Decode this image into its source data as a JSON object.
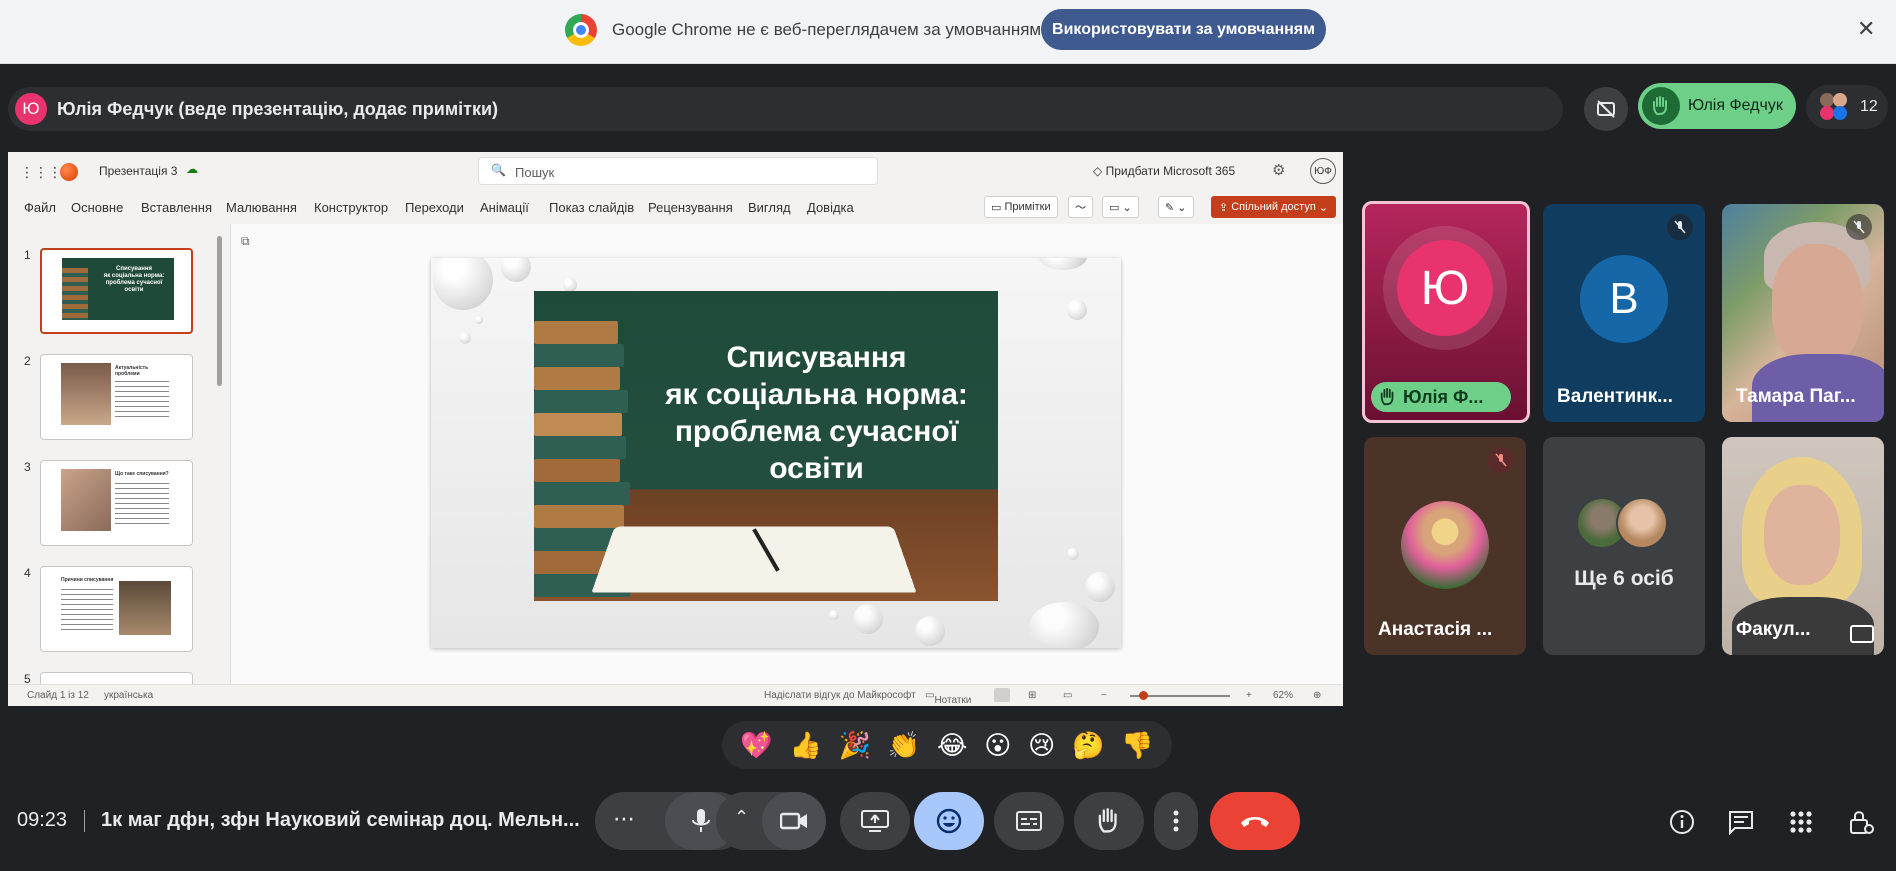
{
  "banner": {
    "message": "Google Chrome не є веб-переглядачем за умовчанням",
    "default_button": "Використовувати за умовчанням",
    "close_glyph": "✕"
  },
  "presenter": {
    "avatar_letter": "Ю",
    "text": "Юлія Федчук (веде презентацію, додає примітки)"
  },
  "top_right": {
    "hand_raised_name": "Юлія Федчук",
    "participants_count": "12"
  },
  "ppt": {
    "doc_title": "Презентація 3",
    "search_placeholder": "Пошук",
    "buy_label": "Придбати Microsoft 365",
    "user_initials": "ЮФ",
    "tabs": [
      "Файл",
      "Основне",
      "Вставлення",
      "Малювання",
      "Конструктор",
      "Переходи",
      "Анімації",
      "Показ слайдів",
      "Рецензування",
      "Вигляд",
      "Довідка"
    ],
    "notes_button": "Примітки",
    "share_button": "Спільний доступ",
    "slide_numbers": [
      "1",
      "2",
      "3",
      "4",
      "5"
    ],
    "thumb_titles": [
      "Списування\nяк соціальна норма:\nпроблема сучасної\nосвіти",
      "Актуальність\nпроблеми",
      "Що таке списування?",
      "Причини списування"
    ],
    "slide_title": "Списування\nяк соціальна норма:\nпроблема сучасної\nосвіти",
    "status": {
      "slide_of": "Слайд 1 із 12",
      "language": "українська",
      "feedback": "Надіслати відгук до Майкрософт",
      "notes": "Нотатки",
      "zoom": "62%"
    }
  },
  "tiles": {
    "t1": {
      "avatar_letter": "Ю",
      "label": "Юлія Ф..."
    },
    "t2": {
      "avatar_letter": "В",
      "label": "Валентинк..."
    },
    "t3": {
      "label": "Тамара Паг..."
    },
    "t4": {
      "label": "Анастасія ..."
    },
    "t5": {
      "label": "Ще 6 осіб"
    },
    "t6": {
      "label": "Факул..."
    }
  },
  "reactions": [
    "💖",
    "👍",
    "🎉",
    "👏",
    "😂",
    "😮",
    "😢",
    "🤔",
    "👎"
  ],
  "bottom": {
    "time": "09:23",
    "meeting_title": "1к маг дфн, зфн Науковий семінар доц. Мельн..."
  },
  "colors": {
    "accent_pink": "#e8336d",
    "hand_green": "#6ed088",
    "end_call_red": "#ea4335",
    "share_orange": "#c43e1c"
  }
}
